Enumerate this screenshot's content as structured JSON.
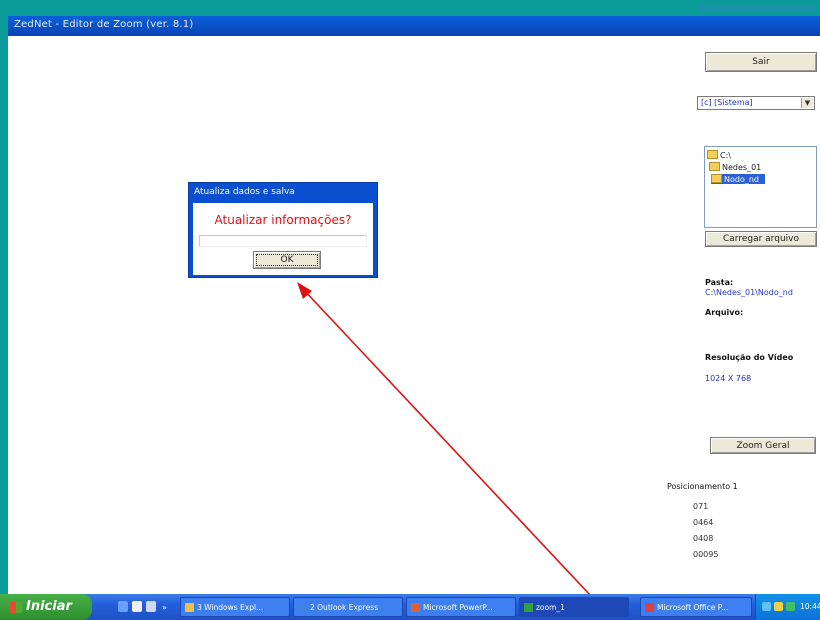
{
  "window": {
    "title": "ZedNet - Editor de Zoom (ver. 8.1)"
  },
  "controls": {
    "exit_label": "Sair",
    "drive_select": "[c] [Sistema]",
    "folder_tree": [
      {
        "label": "C:\\",
        "selected": false
      },
      {
        "label": "Nedes_01",
        "selected": false
      },
      {
        "label": "Nodo_nd",
        "selected": true
      }
    ],
    "choose_file_label": "Carregar arquivo",
    "zoom_general_label": "Zoom Geral"
  },
  "info": {
    "path_label": "Pasta:",
    "path_value": "C:\\Nedes_01\\Nodo_nd",
    "file_label": "Arquivo:",
    "resolution_label": "Resolução do Vídeo",
    "resolution_value": "1024 X 768",
    "zoom_list_label": "Posicionamento 1",
    "zoom_values": [
      "071",
      "0464",
      "0408",
      "00095"
    ]
  },
  "dialog": {
    "title": "Atualiza dados e salva",
    "message": "Atualizar informações?",
    "ok_label": "OK"
  },
  "annotation": {
    "arrow_color": "#e01010"
  },
  "taskbar": {
    "start_label": "Iniciar",
    "tasks": [
      {
        "label": "3 Windows Expl...",
        "icon_color": "#f0c040"
      },
      {
        "label": "2 Outlook Express",
        "icon_color": "#4080e0"
      },
      {
        "label": "Microsoft PowerP...",
        "icon_color": "#e06030"
      },
      {
        "label": "zoom_1",
        "icon_color": "#30a040"
      },
      {
        "label": "Microsoft Office P...",
        "icon_color": "#e04040"
      }
    ],
    "clock": "10:44"
  }
}
